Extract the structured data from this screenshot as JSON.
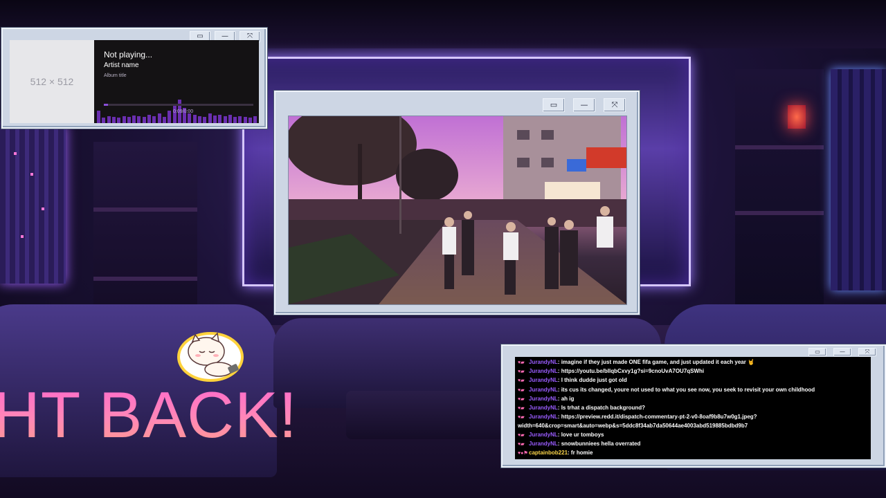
{
  "overlay": {
    "banner_text": "HT BACK!"
  },
  "music_player": {
    "art_placeholder": "512 × 512",
    "title": "Not playing...",
    "artist": "Artist name",
    "album": "Album title",
    "time": "0:09/0:00",
    "progress_fraction": 0.03,
    "accent_color": "#8a4fd8",
    "window_buttons": [
      "▭",
      "—",
      "⤧"
    ]
  },
  "video_window": {
    "window_buttons": [
      "▭",
      "—",
      "⤧"
    ]
  },
  "chat": {
    "window_buttons": [
      "▭",
      "—",
      "⤧"
    ],
    "messages": [
      {
        "user": "JurandyNL",
        "text": "imagine if they just made ONE fifa game, and just updated it each year 🤘",
        "badges": "♥▰"
      },
      {
        "user": "JurandyNL",
        "text": "https://youtu.be/bIlqbCxvy1g?si=9cnoUvA7OU7qSWhi",
        "badges": "♥▰"
      },
      {
        "user": "JurandyNL",
        "text": "I think dudde just got old",
        "badges": "♥▰"
      },
      {
        "user": "JurandyNL",
        "text": "its cus its changed, youre not used to what you see now, you seek to revisit your own childhood",
        "badges": "♥▰"
      },
      {
        "user": "JurandyNL",
        "text": "ah ig",
        "badges": "♥▰"
      },
      {
        "user": "JurandyNL",
        "text": "Is trhat a dispatch background?",
        "badges": "♥▰"
      },
      {
        "user": "JurandyNL",
        "text": "https://preview.redd.it/dispatch-commentary-pt-2-v0-8oaf9b8u7w0g1.jpeg?width=640&crop=smart&auto=webp&s=5ddc8f34ab7da50644ae4003abd519885bdbd9b7",
        "badges": "♥▰"
      },
      {
        "user": "JurandyNL",
        "text": "love ur tomboys",
        "badges": "♥▰"
      },
      {
        "user": "JurandyNL",
        "text": "snowbunniees hella overrated",
        "badges": "♥▰"
      },
      {
        "user": "captainbob221",
        "text": "fr homie",
        "badges": "♥●⚑",
        "gold": true
      }
    ]
  }
}
